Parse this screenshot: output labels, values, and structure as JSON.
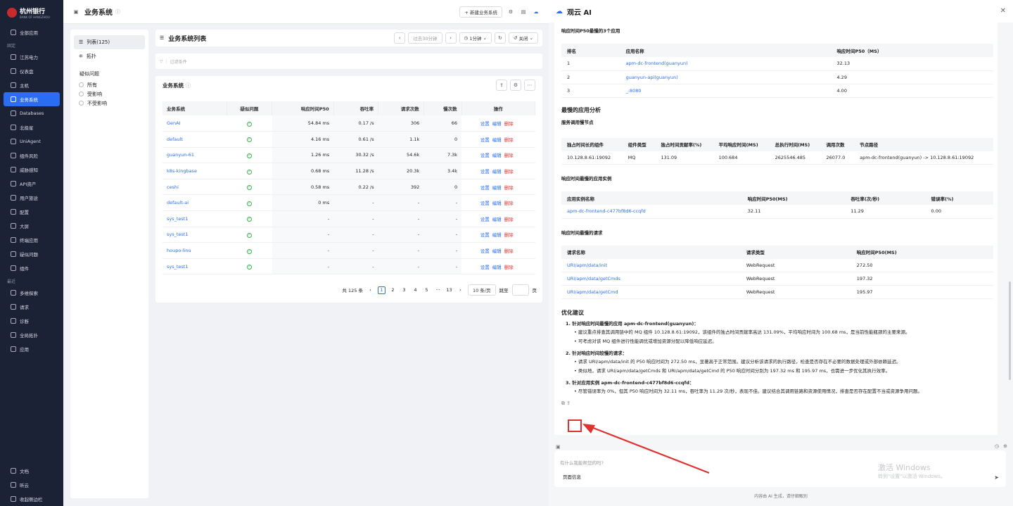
{
  "sidebar": {
    "brand": "杭州银行",
    "brand_sub": "BANK OF HANGZHOU",
    "all_apps": "全部应用",
    "pinned_label": "固定",
    "pinned": [
      "江苏电力",
      "仪表盘",
      "主机",
      "业务系统",
      "Databases",
      "北极星",
      "UniAgent",
      "组件风险",
      "威胁感知",
      "API资产",
      "用户旅途",
      "配置",
      "大屏",
      "终端应用",
      "疑似问题",
      "组件"
    ],
    "recent_label": "最近",
    "recent": [
      "多维探索",
      "请求",
      "诊断",
      "全局拓扑",
      "应用"
    ],
    "bottom": [
      "文档",
      "昕云",
      "收起侧边栏"
    ]
  },
  "main": {
    "title": "业务系统",
    "new_btn": "+ 新建业务系统",
    "list_title": "业务系统列表",
    "time_range": "过去30分钟",
    "refresh": "1分钟",
    "close": "关闭",
    "filter_placeholder": "过滤条件",
    "card_title": "业务系统",
    "view_list": "列表(125)",
    "view_topo": "拓扑",
    "issue_label": "疑似问题",
    "issue_opts": [
      "所有",
      "受影响",
      "不受影响"
    ],
    "columns": [
      "业务系统",
      "疑似问题",
      "响应时间P50",
      "吞吐率",
      "请求次数",
      "慢次数",
      "操作"
    ],
    "rows": [
      [
        "GenAI",
        "54.84 ms",
        "0.17 /s",
        "306",
        "66"
      ],
      [
        "default",
        "4.16 ms",
        "0.61 /s",
        "1.1k",
        "0"
      ],
      [
        "guanyun-61",
        "1.26 ms",
        "30.32 /s",
        "54.6k",
        "7.3k"
      ],
      [
        "k8s-kingbase",
        "0.68 ms",
        "11.28 /s",
        "20.3k",
        "3.4k"
      ],
      [
        "ceshi",
        "0.58 ms",
        "0.22 /s",
        "392",
        "0"
      ],
      [
        "default-ai",
        "0 ms",
        "-",
        "-",
        "-"
      ],
      [
        "sys_test1",
        "-",
        "-",
        "-",
        "-"
      ],
      [
        "sys_test1",
        "-",
        "-",
        "-",
        "-"
      ],
      [
        "houpo-linu",
        "-",
        "-",
        "-",
        "-"
      ],
      [
        "sys_test1",
        "-",
        "-",
        "-",
        "-"
      ]
    ],
    "actions": [
      "设置",
      "编辑",
      "删除"
    ],
    "pager": {
      "total": "共 125 条",
      "pages": [
        "1",
        "2",
        "3",
        "4",
        "5",
        "···",
        "13"
      ],
      "size": "10 条/页",
      "jump": "跳至",
      "unit": "页"
    }
  },
  "ai": {
    "title": "观云 AI",
    "sec1": "响应时间P50最慢的3个应用",
    "t1_cols": [
      "排名",
      "应用名称",
      "响应时间P50（MS）"
    ],
    "t1_rows": [
      [
        "1",
        "apm-dc-frontend(guanyun)",
        "32.13"
      ],
      [
        "2",
        "guanyun-api(guanyun)",
        "4.29"
      ],
      [
        "3",
        "_:8080",
        "4.00"
      ]
    ],
    "sec2": "最慢的应用分析",
    "sec2a": "服务调用慢节点",
    "t2_cols": [
      "独占时间长的组件",
      "组件类型",
      "独占时间贡献率(%)",
      "平均响应时间(MS)",
      "总执行时间(MS)",
      "调用次数",
      "节点路径"
    ],
    "t2_rows": [
      [
        "10.128.8.61:19092",
        "MQ",
        "131.09",
        "100.684",
        "2625546.485",
        "26077.0",
        "apm-dc-frontend(guanyun) -> 10.128.8.61:19092"
      ]
    ],
    "sec3": "响应时间最慢的应用实例",
    "t3_cols": [
      "应用实例名称",
      "响应时间P50(MS)",
      "吞吐率(次/秒)",
      "错误率(%)"
    ],
    "t3_rows": [
      [
        "apm-dc-frontend-c477bf8d6-ccqfd",
        "32.11",
        "11.29",
        "0.00"
      ]
    ],
    "sec4": "响应时间最慢的请求",
    "t4_cols": [
      "请求名称",
      "请求类型",
      "响应时间P50(MS)"
    ],
    "t4_rows": [
      [
        "URI/apm/data/init",
        "WebRequest",
        "272.50"
      ],
      [
        "URI/apm/data/getCmds",
        "WebRequest",
        "197.32"
      ],
      [
        "URI/apm/data/getCmd",
        "WebRequest",
        "195.97"
      ]
    ],
    "sec5": "优化建议",
    "s1": "1. 针对响应时间最慢的应用 apm-dc-frontend(guanyun)：",
    "s1b": [
      "建议重点排查其调用链中的 MQ 组件 10.128.8.61:19092，该组件的独占时间贡献率高达 131.09%，平均响应时间为 100.68 ms，是当前性能瓶颈的主要来源。",
      "可考虑对该 MQ 组件进行性能调优或增加资源分配以降低响应延迟。"
    ],
    "s2": "2. 针对响应时间较慢的请求：",
    "s2b": [
      "请求 URI/apm/data/init 的 P50 响应时间为 272.50 ms，显著高于正常范围。建议分析该请求的执行路径，检查是否存在不必要的数据处理或外部依赖延迟。",
      "类似地，请求 URI/apm/data/getCmds 和 URI/apm/data/getCmd 的 P50 响应时间分别为 197.32 ms 和 195.97 ms，也需进一步优化其执行效率。"
    ],
    "s3": "3. 针对应用实例 apm-dc-frontend-c477bf8d6-ccqfd：",
    "s3b": [
      "尽管错误率为 0%，但其 P50 响应时间为 32.11 ms，吞吐率为 11.29 次/秒，表现不佳。建议结合其调用链路和资源使用情况，排查是否存在配置不当或资源争用问题。"
    ],
    "input_placeholder": "有什么我能帮您的吗?",
    "page_info": "页面信息",
    "note": "内容由 AI 生成，请仔细甄别",
    "wm1": "激活 Windows",
    "wm2": "转到\"设置\"以激活 Windows。"
  }
}
